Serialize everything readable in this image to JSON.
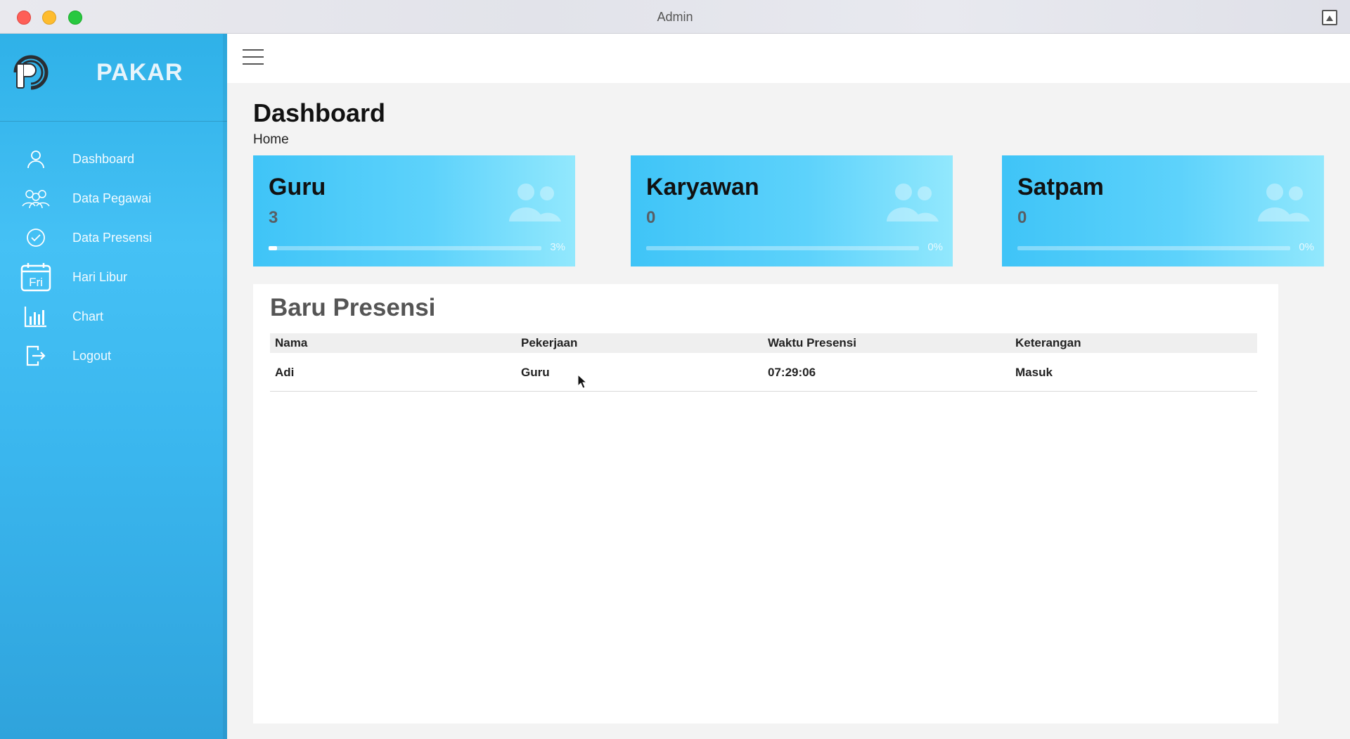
{
  "window": {
    "title": "Admin"
  },
  "brand": {
    "name": "PAKAR"
  },
  "sidebar": {
    "items": [
      {
        "label": "Dashboard",
        "icon": "user-icon"
      },
      {
        "label": "Data Pegawai",
        "icon": "users-group-icon"
      },
      {
        "label": "Data Presensi",
        "icon": "check-circle-icon"
      },
      {
        "label": "Hari Libur",
        "icon": "calendar-icon",
        "icon_text": "Fri"
      },
      {
        "label": "Chart",
        "icon": "bar-chart-icon"
      },
      {
        "label": "Logout",
        "icon": "logout-icon"
      }
    ]
  },
  "header": {
    "menu_icon": "hamburger-icon"
  },
  "page": {
    "title": "Dashboard",
    "breadcrumb": "Home"
  },
  "cards": [
    {
      "title": "Guru",
      "count": "3",
      "percent_label": "3%",
      "progress": 0.03
    },
    {
      "title": "Karyawan",
      "count": "0",
      "percent_label": "0%",
      "progress": 0
    },
    {
      "title": "Satpam",
      "count": "0",
      "percent_label": "0%",
      "progress": 0
    }
  ],
  "attendance": {
    "title": "Baru Presensi",
    "columns": [
      "Nama",
      "Pekerjaan",
      "Waktu Presensi",
      "Keterangan"
    ],
    "rows": [
      [
        "Adi",
        "Guru",
        "07:29:06",
        "Masuk"
      ]
    ]
  },
  "colors": {
    "sidebar": "#3ab6ee",
    "card": "#5dd2fb",
    "accent_white": "#ffffff"
  }
}
